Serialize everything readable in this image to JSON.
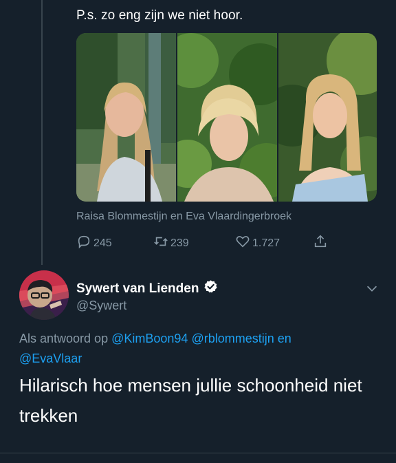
{
  "quoted_tweet": {
    "text": "P.s. zo eng zijn we niet hoor.",
    "media_tags": "Raisa Blommestijn en Eva Vlaardingerbroek",
    "stats": {
      "replies": "245",
      "retweets": "239",
      "likes": "1.727"
    }
  },
  "reply_tweet": {
    "display_name": "Sywert van Lienden",
    "handle": "@Sywert",
    "reply_to_prefix": "Als antwoord op",
    "reply_to_mentions": [
      "@KimBoon94",
      "@rblommestijn",
      "@EvaVlaar"
    ],
    "reply_to_joiner": "en",
    "text": "Hilarisch hoe mensen jullie schoonheid niet trekken"
  },
  "icons": {
    "reply": "reply-icon",
    "retweet": "retweet-icon",
    "like": "heart-icon",
    "share": "share-icon",
    "verified": "verified-badge-icon",
    "menu": "chevron-down-icon"
  },
  "colors": {
    "background": "#15202b",
    "secondary_text": "#8899a6",
    "link": "#1da1f2",
    "divider": "#38444d"
  }
}
